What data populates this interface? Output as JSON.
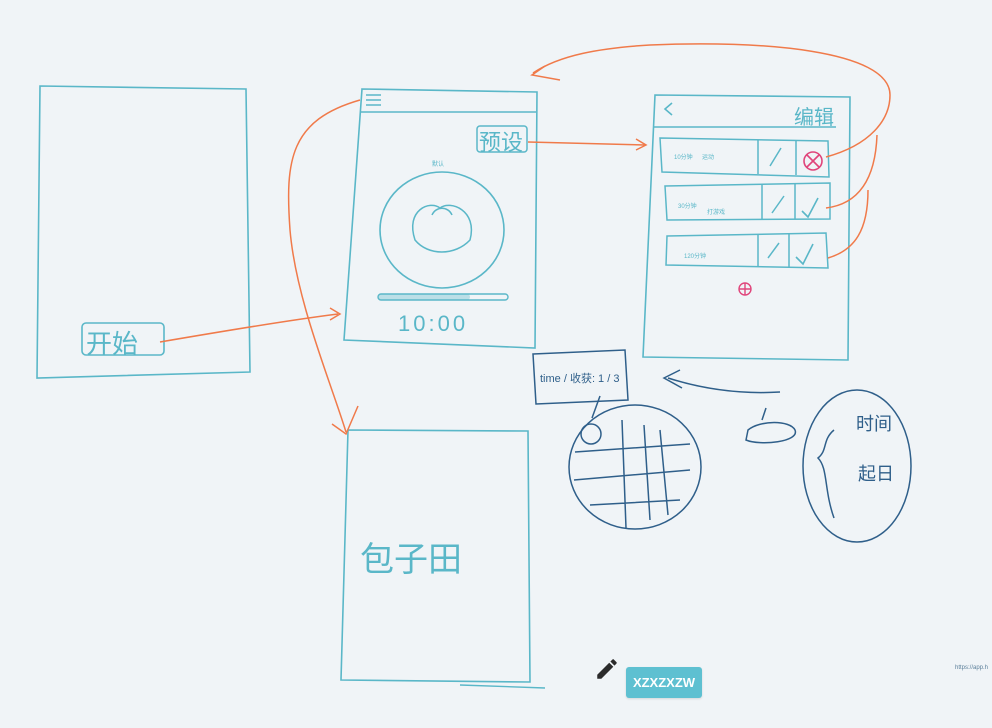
{
  "colors": {
    "background": "#f0f4f7",
    "sketch_cyan": "#5ab7c8",
    "sketch_orange": "#f07a4a",
    "sketch_navy": "#2f5f8a",
    "sketch_red": "#e0457b",
    "button": "#5ec0d1"
  },
  "screens": {
    "home": {
      "start_label": "开始"
    },
    "timer": {
      "preset_label": "预设",
      "small_caption": "默认",
      "time": "10:00"
    },
    "presets": {
      "edit_label": "编辑",
      "rows": [
        {
          "duration": "10分钟",
          "activity": "运动"
        },
        {
          "duration": "30分钟",
          "activity": "打游戏"
        },
        {
          "duration": "120分钟",
          "activity": ""
        }
      ]
    },
    "field": {
      "label": "包子田"
    }
  },
  "notes": {
    "card_text": "time / 收获: 1 / 3",
    "bubble_labels": [
      "时间",
      "起日"
    ]
  },
  "toolbar": {
    "pencil_icon": "pencil-icon",
    "user_button_label": "XZXZXZW"
  },
  "footer": {
    "url_text": "https://app.h"
  }
}
